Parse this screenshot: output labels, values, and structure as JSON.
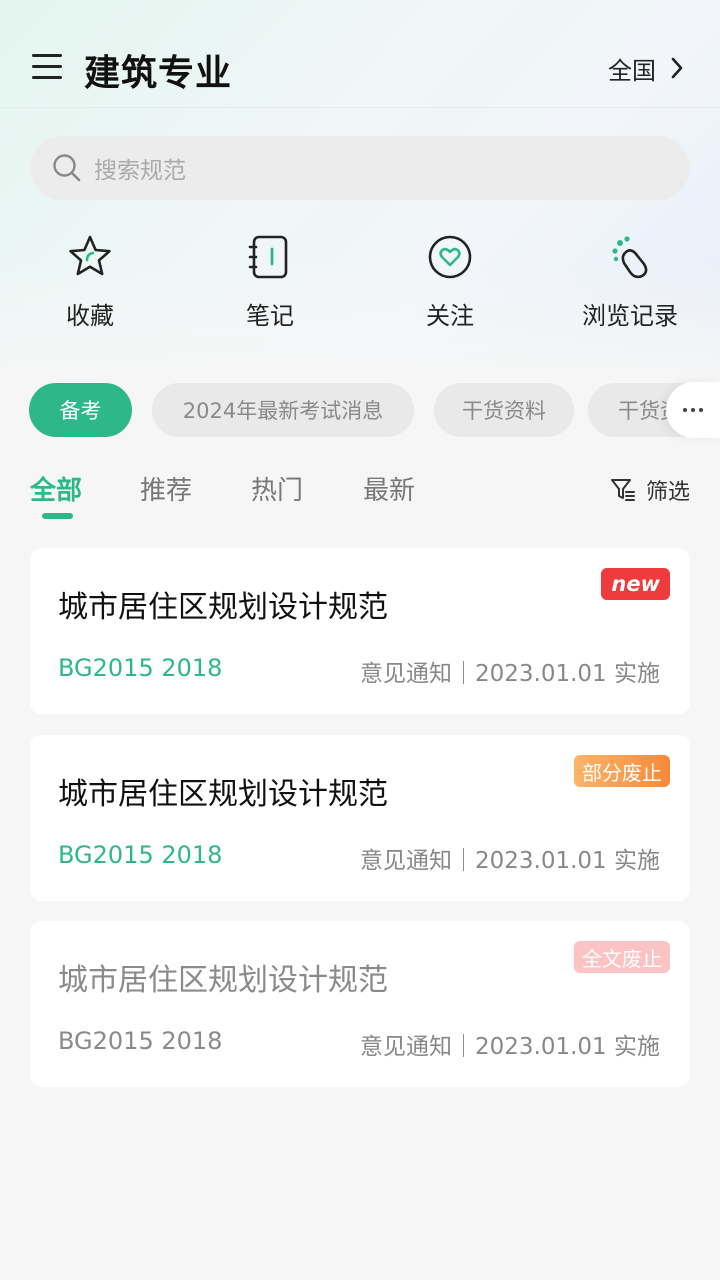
{
  "header": {
    "title": "建筑专业",
    "region": "全国"
  },
  "search": {
    "placeholder": "搜索规范"
  },
  "quick_actions": [
    {
      "label": "收藏",
      "icon": "star-icon"
    },
    {
      "label": "笔记",
      "icon": "notebook-icon"
    },
    {
      "label": "关注",
      "icon": "heart-icon"
    },
    {
      "label": "浏览记录",
      "icon": "footprint-icon"
    }
  ],
  "chips": [
    {
      "label": "备考",
      "active": true
    },
    {
      "label": "2024年最新考试消息",
      "active": false
    },
    {
      "label": "干货资料",
      "active": false
    },
    {
      "label": "干货资料",
      "active": false
    }
  ],
  "tabs": [
    {
      "label": "全部",
      "active": true
    },
    {
      "label": "推荐",
      "active": false
    },
    {
      "label": "热门",
      "active": false
    },
    {
      "label": "最新",
      "active": false
    }
  ],
  "filter": {
    "label": "筛选"
  },
  "cards": [
    {
      "title": "城市居住区规划设计规范",
      "code": "BG2015 2018",
      "meta": "意见通知｜2023.01.01 实施",
      "badge": "new",
      "status": "new"
    },
    {
      "title": "城市居住区规划设计规范",
      "code": "BG2015 2018",
      "meta": "意见通知｜2023.01.01 实施",
      "badge": "部分废止",
      "status": "partial"
    },
    {
      "title": "城市居住区规划设计规范",
      "code": "BG2015 2018",
      "meta": "意见通知｜2023.01.01 实施",
      "badge": "全文废止",
      "status": "full"
    }
  ],
  "colors": {
    "accent": "#2eb88a",
    "new_badge": "#ef3b3b",
    "partial_badge": "#f78a3a",
    "full_badge": "#fbc3c3"
  }
}
